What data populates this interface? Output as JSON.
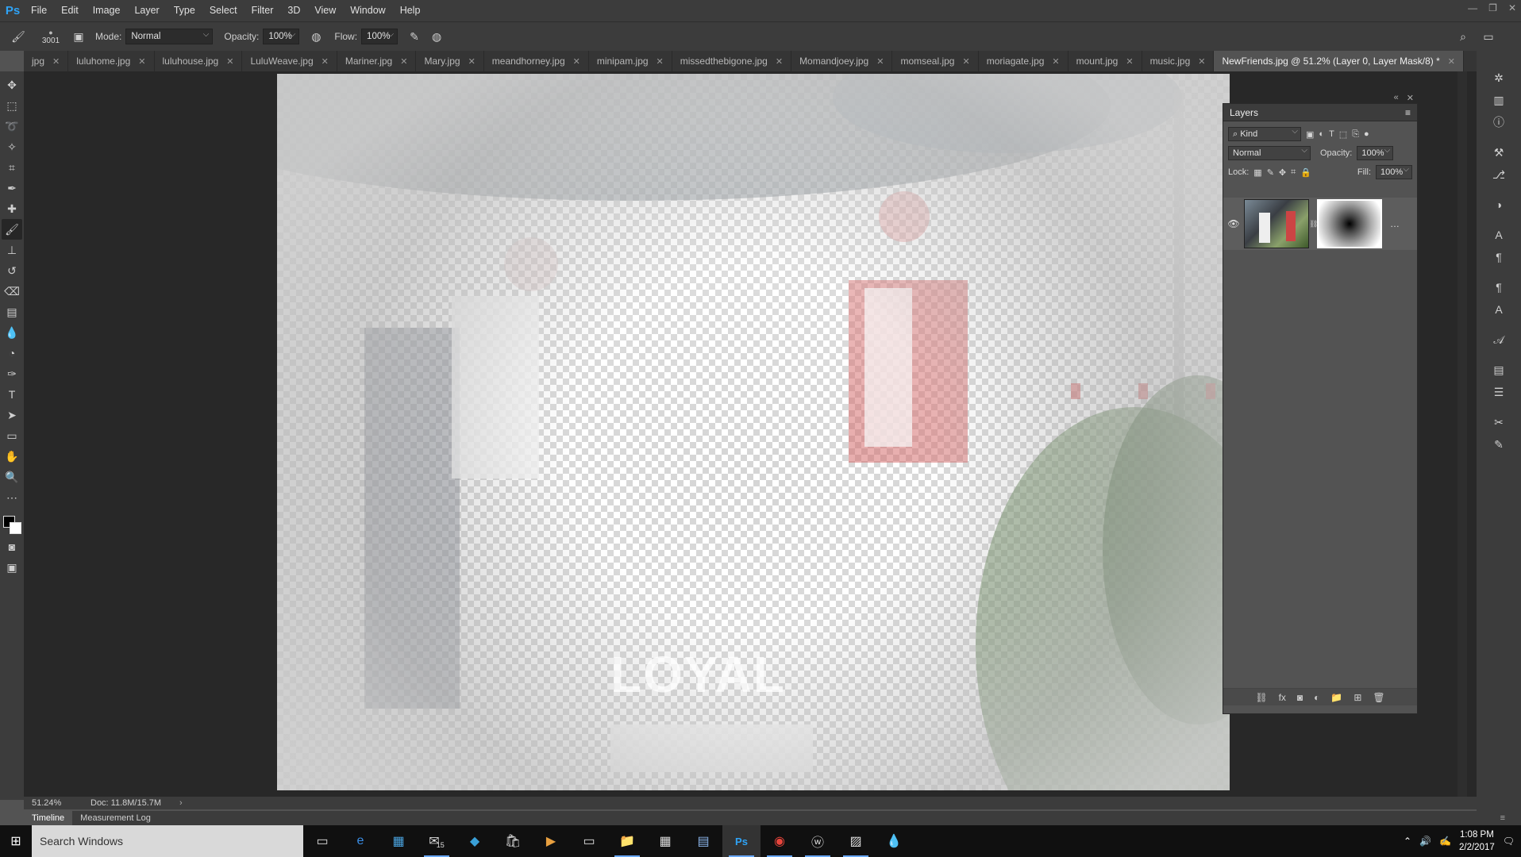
{
  "app": {
    "logo": "Ps",
    "menu": [
      "File",
      "Edit",
      "Image",
      "Layer",
      "Type",
      "Select",
      "Filter",
      "3D",
      "View",
      "Window",
      "Help"
    ]
  },
  "options": {
    "brush_size": "3001",
    "mode_label": "Mode:",
    "mode_value": "Normal",
    "opacity_label": "Opacity:",
    "opacity_value": "100%",
    "flow_label": "Flow:",
    "flow_value": "100%"
  },
  "tabs": [
    {
      "label": "jpg"
    },
    {
      "label": "luluhome.jpg"
    },
    {
      "label": "luluhouse.jpg"
    },
    {
      "label": "LuluWeave.jpg"
    },
    {
      "label": "Mariner.jpg"
    },
    {
      "label": "Mary.jpg"
    },
    {
      "label": "meandhorney.jpg"
    },
    {
      "label": "minipam.jpg"
    },
    {
      "label": "missedthebigone.jpg"
    },
    {
      "label": "Momandjoey.jpg"
    },
    {
      "label": "momseal.jpg"
    },
    {
      "label": "moriagate.jpg"
    },
    {
      "label": "mount.jpg"
    },
    {
      "label": "music.jpg"
    },
    {
      "label": "NewFriends.jpg @ 51.2% (Layer 0, Layer Mask/8) *"
    }
  ],
  "canvas": {
    "sign_text": "LOYAL"
  },
  "status": {
    "zoom": "51.24%",
    "doc": "Doc: 11.8M/15.7M"
  },
  "timeline": {
    "tabs": [
      "Timeline",
      "Measurement Log"
    ]
  },
  "layers": {
    "title": "Layers",
    "kind": "Kind",
    "blend_mode": "Normal",
    "opacity_label": "Opacity:",
    "opacity_value": "100%",
    "lock_label": "Lock:",
    "fill_label": "Fill:",
    "fill_value": "100%"
  },
  "taskbar": {
    "search_placeholder": "Search Windows",
    "mail_badge": "15",
    "time": "1:08 PM",
    "date": "2/2/2017"
  }
}
